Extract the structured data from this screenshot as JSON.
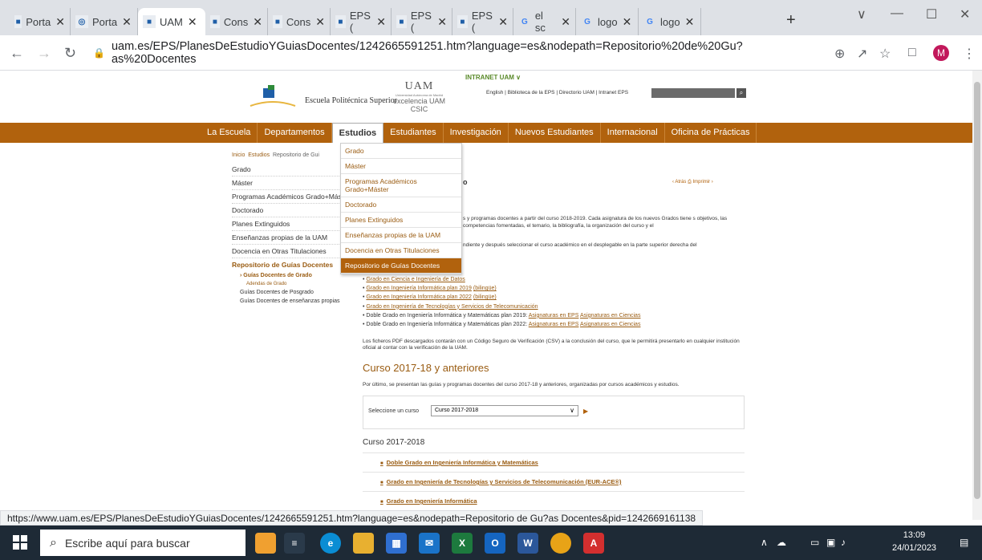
{
  "browser": {
    "tabs": [
      {
        "label": "Porta",
        "icon": "uam-icon"
      },
      {
        "label": "Porta",
        "icon": "globe-icon"
      },
      {
        "label": "UAM",
        "icon": "uam-eps-icon",
        "active": true
      },
      {
        "label": "Cons",
        "icon": "uam-logo-icon"
      },
      {
        "label": "Cons",
        "icon": "uam-logo-icon"
      },
      {
        "label": "EPS (",
        "icon": "uam-eps-icon"
      },
      {
        "label": "EPS (",
        "icon": "uam-eps-icon"
      },
      {
        "label": "EPS (",
        "icon": "uam-eps-icon"
      },
      {
        "label": "el sc",
        "icon": "google-icon"
      },
      {
        "label": "logo",
        "icon": "google-icon"
      },
      {
        "label": "logo",
        "icon": "google-icon"
      }
    ],
    "new_tab": "+",
    "url": "uam.es/EPS/PlanesDeEstudioYGuiasDocentes/1242665591251.htm?language=es&nodepath=Repositorio%20de%20Gu?as%20Docentes",
    "avatar_letter": "M"
  },
  "site": {
    "intranet": "INTRANET UAM  ∨",
    "eps_name": "Escuela Politécnica Superior",
    "uam_logo": "UAM",
    "uam_sub": "Universidad Autónoma de Madrid",
    "excelencia": "excelencia UAM CSIC",
    "top_links": "English | Biblioteca de la EPS | Directorio UAM | Intranet EPS",
    "nav": [
      "La Escuela",
      "Departamentos",
      "Estudios",
      "Estudiantes",
      "Investigación",
      "Nuevos Estudiantes",
      "Internacional",
      "Oficina de Prácticas"
    ],
    "nav_active": "Estudios",
    "dropdown": [
      "Grado",
      "Máster",
      "Programas Académicos Grado+Máster",
      "Doctorado",
      "Planes Extinguidos",
      "Enseñanzas propias de la UAM",
      "Docencia en Otras Titulaciones",
      "Repositorio de Guías Docentes"
    ],
    "breadcrumb": {
      "inicio": "Inicio",
      "estudios": "Estudios",
      "repo": "Repositorio de Gui"
    },
    "left_nav": [
      "Grado",
      "Máster",
      "Programas Académicos Grado+Máster",
      "Doctorado",
      "Planes Extinguidos",
      "Enseñanzas propias de la UAM",
      "Docencia en Otras Titulaciones"
    ],
    "left_sel": "Repositorio de Guías Docentes",
    "left_sub": "› Guías Docentes de Grado",
    "left_sub2": "Adendas de Grado",
    "left_sub3": [
      "Guías Docentes de Posgrado",
      "Guías Docentes de enseñanzas propias"
    ],
    "content_head": "o",
    "tools": "‹ Atrás   ⎙ Imprimir ›",
    "para1": "s y programas docentes a partir del curso 2018-2019. Cada asignatura de los nuevos Grados tiene s objetivos, las competencias fomentadas, el temario, la bibliografía, la organización del curso y el",
    "para2": "ndiente y después seleccionar el curso académico en el desplegable en la parte superior derecha del",
    "grados": [
      {
        "a": "Grado en Ciencia e Ingeniería de Datos",
        "b": ""
      },
      {
        "a": "Grado en Ingeniería Informática plan 2019",
        "b": "(bilingüe)"
      },
      {
        "a": "Grado en Ingeniería Informática plan 2022",
        "b": "(bilingüe)"
      },
      {
        "a": "Grado en Ingeniería de Tecnologías y Servicios de Telecomunicación",
        "b": ""
      }
    ],
    "doble1_pre": "Doble Grado en Ingeniería Informática y Matemáticas plan 2019: ",
    "doble2_pre": "Doble Grado en Ingeniería Informática y Matemáticas plan 2022: ",
    "asig_eps": "Asignaturas en EPS",
    "asig_cien": "Asignaturas en Ciencias",
    "pdf_note": "Los ficheros PDF descargados contarán con un Código Seguro de Verificación (CSV) a la conclusión del curso, que le permitirá presentarlo en cualquier institución oficial al contar con la verificación de la UAM.",
    "h2": "Curso 2017-18 y anteriores",
    "para3": "Por último, se presentan las guías y programas docentes del curso 2017-18 y anteriores, organizadas por cursos académicos y estudios.",
    "select_label": "Seleccione un curso",
    "select_value": "Curso 2017-2018",
    "year_title": "Curso 2017-2018",
    "degrees": [
      "Doble Grado en Ingeniería Informática y Matemáticas",
      "Grado en Ingeniería de Tecnologías y Servicios de Telecomunicación (EUR-ACE®)",
      "Grado en Ingeniería Informática"
    ]
  },
  "status_url": "https://www.uam.es/EPS/PlanesDeEstudioYGuiasDocentes/1242665591251.htm?language=es&nodepath=Repositorio de Gu?as Docentes&pid=1242669161138",
  "taskbar": {
    "search_placeholder": "Escribe aquí para buscar",
    "time": "13:09",
    "date": "24/01/2023"
  }
}
